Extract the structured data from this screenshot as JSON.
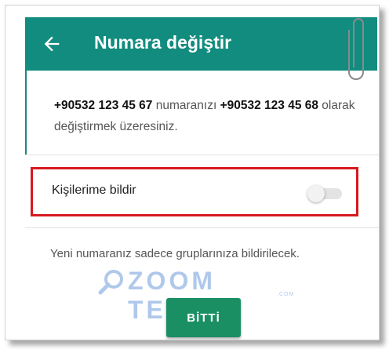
{
  "header": {
    "title": "Numara değiştir",
    "back_icon": "arrow-left-icon"
  },
  "message": {
    "old_number": "+90532 123 45 67",
    "middle_text": " numaranızı ",
    "new_number": "+90532 123 45 68",
    "end_text": " olarak değiştirmek üzeresiniz."
  },
  "notify": {
    "label": "Kişilerime bildir",
    "enabled": false
  },
  "info_text": "Yeni numaranız sadece gruplarınıza bildirilecek.",
  "watermark": {
    "text": "ZOOM TEKNO",
    "sub": ".COM"
  },
  "done_button": {
    "label": "BİTTİ"
  },
  "colors": {
    "appbar": "#128C7E",
    "highlight": "#d7191f",
    "button": "#1a8f64"
  }
}
